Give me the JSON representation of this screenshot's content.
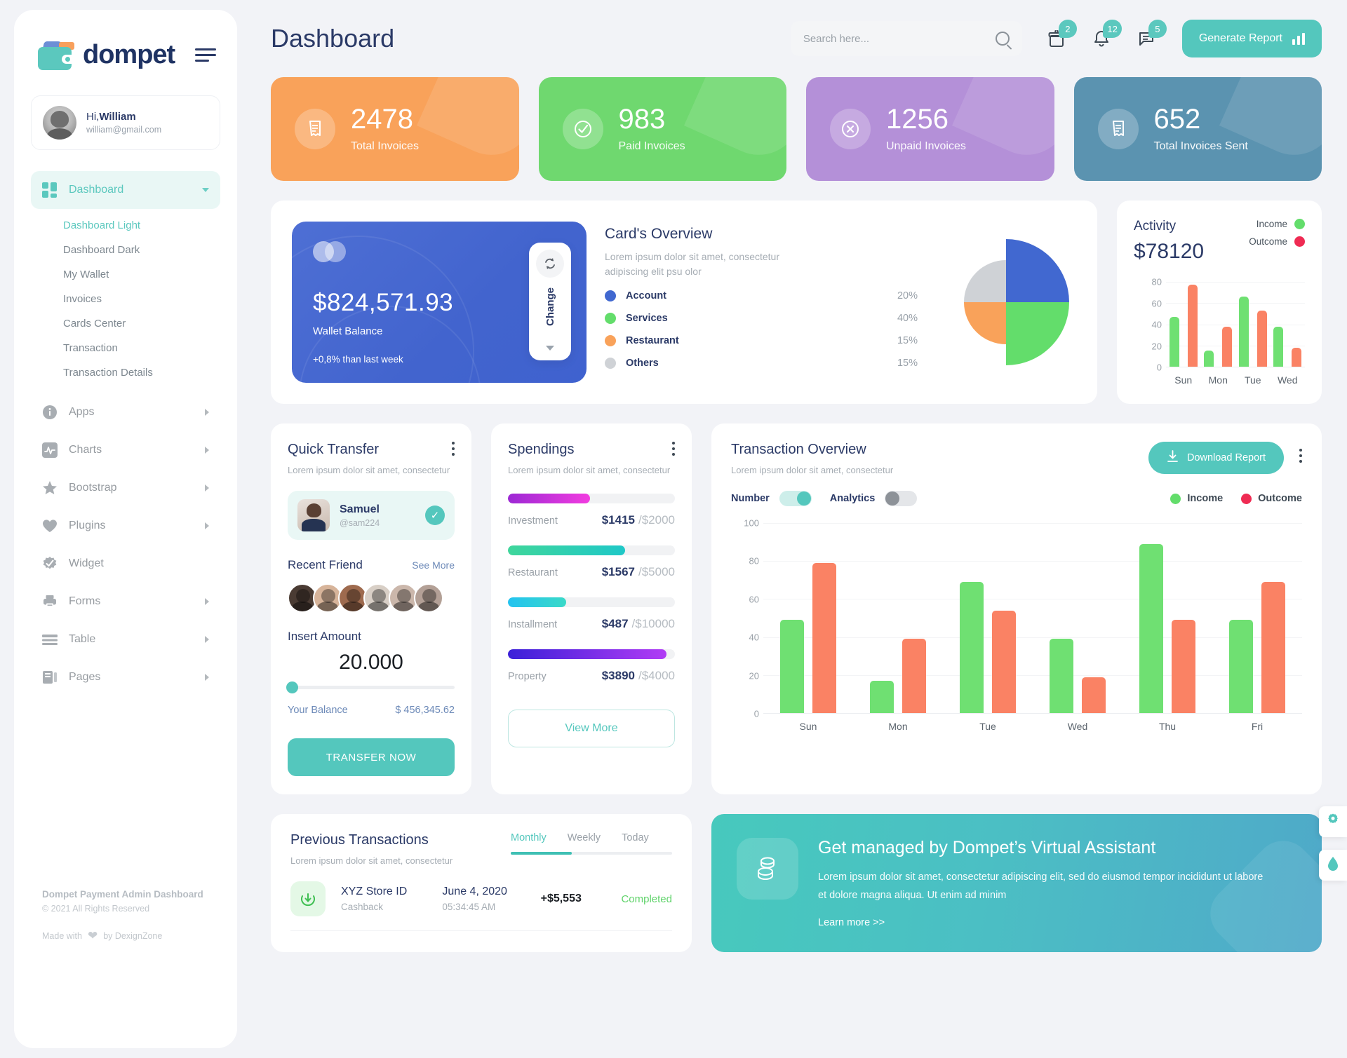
{
  "brand": {
    "name": "dompet",
    "logo_icon": "wallet-icon",
    "menu_icon": "hamburger-icon"
  },
  "profile": {
    "greeting_prefix": "Hi,",
    "name": "William",
    "email": "william@gmail.com"
  },
  "sidebar": {
    "items": [
      {
        "label": "Dashboard",
        "icon": "grid-icon",
        "active": true,
        "caret": "down"
      },
      {
        "label": "Apps",
        "icon": "info-icon",
        "active": false,
        "caret": "right"
      },
      {
        "label": "Charts",
        "icon": "chart-line-icon",
        "active": false,
        "caret": "right"
      },
      {
        "label": "Bootstrap",
        "icon": "star-icon",
        "active": false,
        "caret": "right"
      },
      {
        "label": "Plugins",
        "icon": "heart-icon",
        "active": false,
        "caret": "right"
      },
      {
        "label": "Widget",
        "icon": "check-badge-icon",
        "active": false,
        "caret": "none"
      },
      {
        "label": "Forms",
        "icon": "printer-icon",
        "active": false,
        "caret": "right"
      },
      {
        "label": "Table",
        "icon": "table-icon",
        "active": false,
        "caret": "right"
      },
      {
        "label": "Pages",
        "icon": "pages-icon",
        "active": false,
        "caret": "right"
      }
    ],
    "submenu": [
      {
        "label": "Dashboard Light",
        "active": true
      },
      {
        "label": "Dashboard Dark",
        "active": false
      },
      {
        "label": "My Wallet",
        "active": false
      },
      {
        "label": "Invoices",
        "active": false
      },
      {
        "label": "Cards Center",
        "active": false
      },
      {
        "label": "Transaction",
        "active": false
      },
      {
        "label": "Transaction Details",
        "active": false
      }
    ],
    "footer": {
      "title": "Dompet Payment Admin Dashboard",
      "copyright": "© 2021 All Rights Reserved",
      "made_prefix": "Made with",
      "made_suffix": "by DexignZone"
    }
  },
  "header": {
    "title": "Dashboard",
    "search_placeholder": "Search here...",
    "search_value": "",
    "search_icon": "search-icon",
    "icons": [
      {
        "name": "gift-icon",
        "badge": "2"
      },
      {
        "name": "bell-icon",
        "badge": "12"
      },
      {
        "name": "message-icon",
        "badge": "5"
      }
    ],
    "generate_report": "Generate Report"
  },
  "stats": [
    {
      "value": "2478",
      "label": "Total Invoices",
      "color": "#f9a25a",
      "icon": "invoice-icon"
    },
    {
      "value": "983",
      "label": "Paid Invoices",
      "color": "#6fd86f",
      "icon": "check-circle-icon"
    },
    {
      "value": "1256",
      "label": "Unpaid Invoices",
      "color": "#b490d8",
      "icon": "x-circle-icon"
    },
    {
      "value": "652",
      "label": "Total Invoices Sent",
      "color": "#5b93b0",
      "icon": "invoice-sent-icon"
    }
  ],
  "wallet": {
    "amount": "$824,571.93",
    "label": "Wallet Balance",
    "delta": "+0,8% than last week",
    "change_label": "Change",
    "refresh_icon": "refresh-icon"
  },
  "cards_overview": {
    "title": "Card's Overview",
    "subtitle": "Lorem ipsum dolor sit amet, consectetur adipiscing elit psu olor",
    "chart_data": {
      "type": "pie",
      "title": "Card's Overview",
      "labels": [
        "Account",
        "Services",
        "Restaurant",
        "Others"
      ],
      "values": [
        20,
        40,
        15,
        15
      ],
      "value_labels": [
        "20%",
        "40%",
        "15%",
        "15%"
      ],
      "colors": [
        "#4168d0",
        "#63dd6b",
        "#f9a25a",
        "#cfd2d6"
      ],
      "legend": "left"
    }
  },
  "activity": {
    "title": "Activity",
    "amount": "$78120",
    "legend": [
      {
        "label": "Income",
        "color": "#63dd6b"
      },
      {
        "label": "Outcome",
        "color": "#ef2b53"
      }
    ],
    "chart_data": {
      "type": "bar",
      "title": "Activity",
      "categories": [
        "Sun",
        "Mon",
        "Tue",
        "Wed"
      ],
      "series": [
        {
          "name": "Income",
          "values": [
            47,
            15,
            66,
            38
          ],
          "color": "#6fe072"
        },
        {
          "name": "Outcome",
          "values": [
            77,
            38,
            53,
            18
          ],
          "color": "#fa8264"
        }
      ],
      "ylim": [
        0,
        80
      ],
      "yticks": [
        0,
        20,
        40,
        60,
        80
      ],
      "ylabel": "",
      "xlabel": "",
      "grid": true
    }
  },
  "quick_transfer": {
    "title": "Quick Transfer",
    "subtitle": "Lorem ipsum dolor sit amet, consectetur",
    "selected_friend": {
      "name": "Samuel",
      "handle": "@sam224",
      "selected_icon": "check-circle-icon"
    },
    "recent_friend_label": "Recent Friend",
    "see_more": "See More",
    "friend_count": 6,
    "insert_amount_label": "Insert Amount",
    "amount_value": "20.000",
    "balance_label": "Your Balance",
    "balance_value": "$ 456,345.62",
    "transfer_button": "TRANSFER NOW"
  },
  "spendings": {
    "title": "Spendings",
    "subtitle": "Lorem ipsum dolor sit amet, consectetur",
    "view_more": "View More",
    "items": [
      {
        "name": "Investment",
        "amount": "$1415",
        "max": "/$2000",
        "pct": 49,
        "from": "#9c28d4",
        "to": "#f23ce0"
      },
      {
        "name": "Restaurant",
        "amount": "$1567",
        "max": "/$5000",
        "pct": 70,
        "from": "#3fd69b",
        "to": "#1fc8c8"
      },
      {
        "name": "Installment",
        "amount": "$487",
        "max": "/$10000",
        "pct": 35,
        "from": "#23c3f0",
        "to": "#3ad9c8"
      },
      {
        "name": "Property",
        "amount": "$3890",
        "max": "/$4000",
        "pct": 95,
        "from": "#3b20d8",
        "to": "#b13cf5"
      }
    ]
  },
  "transaction_overview": {
    "title": "Transaction Overview",
    "subtitle": "Lorem ipsum dolor sit amet, consectetur",
    "download_button": "Download Report",
    "download_icon": "download-icon",
    "toggles": [
      {
        "label": "Number",
        "state": "on"
      },
      {
        "label": "Analytics",
        "state": "off"
      }
    ],
    "legend": [
      {
        "label": "Income",
        "color": "#63dd6b"
      },
      {
        "label": "Outcome",
        "color": "#ef2b53"
      }
    ],
    "chart_data": {
      "type": "bar",
      "title": "Transaction Overview",
      "categories": [
        "Sun",
        "Mon",
        "Tue",
        "Wed",
        "Thu",
        "Fri"
      ],
      "series": [
        {
          "name": "Income",
          "values": [
            49,
            17,
            69,
            39,
            89,
            49
          ],
          "color": "#6fe072"
        },
        {
          "name": "Outcome",
          "values": [
            79,
            39,
            54,
            19,
            49,
            69
          ],
          "color": "#fa8264"
        }
      ],
      "ylim": [
        0,
        100
      ],
      "yticks": [
        0,
        20,
        40,
        60,
        80,
        100
      ],
      "ylabel": "",
      "xlabel": "",
      "grid": true
    }
  },
  "previous_transactions": {
    "title": "Previous Transactions",
    "subtitle": "Lorem ipsum dolor sit amet, consectetur",
    "tabs": [
      {
        "label": "Monthly",
        "active": true
      },
      {
        "label": "Weekly",
        "active": false
      },
      {
        "label": "Today",
        "active": false
      }
    ],
    "rows": [
      {
        "name": "XYZ Store ID",
        "type": "Cashback",
        "date": "June 4, 2020",
        "time": "05:34:45 AM",
        "amount": "+$5,553",
        "status": "Completed",
        "status_color": "#5fd36a",
        "icon": "arrow-down-circle-icon",
        "icon_bg": "#e4f8e6",
        "icon_color": "#3fbf52"
      }
    ]
  },
  "assistant": {
    "title": "Get managed by Dompet’s Virtual Assistant",
    "body": "Lorem ipsum dolor sit amet, consectetur adipiscing elit, sed do eiusmod tempor incididunt ut labore et dolore magna aliqua. Ut enim ad minim",
    "link": "Learn more >>",
    "icon": "coins-icon"
  },
  "floating_buttons": [
    {
      "name": "settings-gear",
      "icon": "gear-icon",
      "color": "#54c7bd"
    },
    {
      "name": "theme-drop",
      "icon": "droplet-icon",
      "color": "#54c7bd"
    }
  ]
}
